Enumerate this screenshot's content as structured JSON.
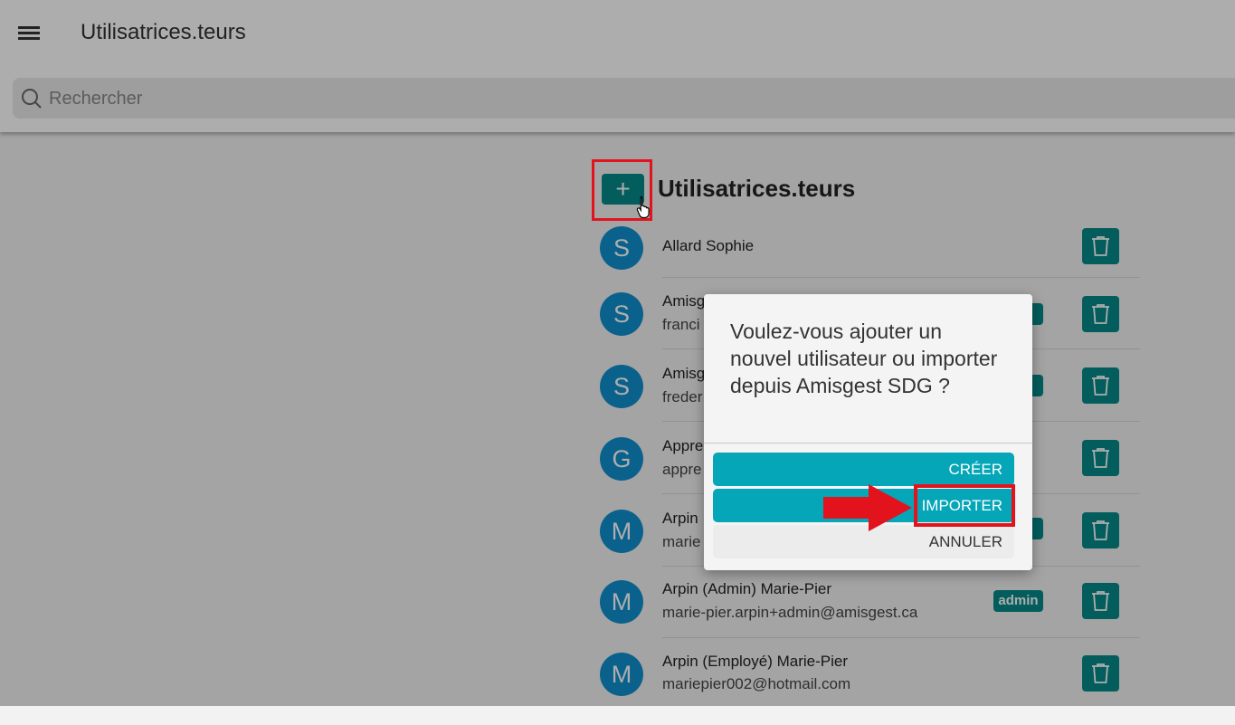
{
  "header": {
    "title": "Utilisatrices.teurs",
    "search_placeholder": "Rechercher"
  },
  "list": {
    "title": "Utilisatrices.teurs",
    "add_label": "+",
    "users": [
      {
        "initial": "S",
        "name": "Allard Sophie",
        "email": "",
        "badge": ""
      },
      {
        "initial": "S",
        "name": "Amisg",
        "email": "franci",
        "badge": ""
      },
      {
        "initial": "S",
        "name": "Amisg",
        "email": "freder",
        "badge": ""
      },
      {
        "initial": "G",
        "name": "Appre",
        "email": "appre",
        "badge": ""
      },
      {
        "initial": "M",
        "name": "Arpin",
        "email": "marie",
        "badge": ""
      },
      {
        "initial": "M",
        "name": "Arpin (Admin) Marie-Pier",
        "email": "marie-pier.arpin+admin@amisgest.ca",
        "badge": "admin"
      },
      {
        "initial": "M",
        "name": "Arpin (Employé) Marie-Pier",
        "email": "mariepier002@hotmail.com",
        "badge": ""
      }
    ]
  },
  "dialog": {
    "message": "Voulez-vous ajouter un nouvel utilisateur ou importer depuis Amisgest SDG ?",
    "create_label": "CRÉER",
    "import_label": "IMPORTER",
    "cancel_label": "ANNULER"
  },
  "colors": {
    "teal": "#058a8a",
    "dialog_button": "#04a6b8",
    "avatar": "#0f8fcf",
    "highlight": "#e3131d"
  }
}
